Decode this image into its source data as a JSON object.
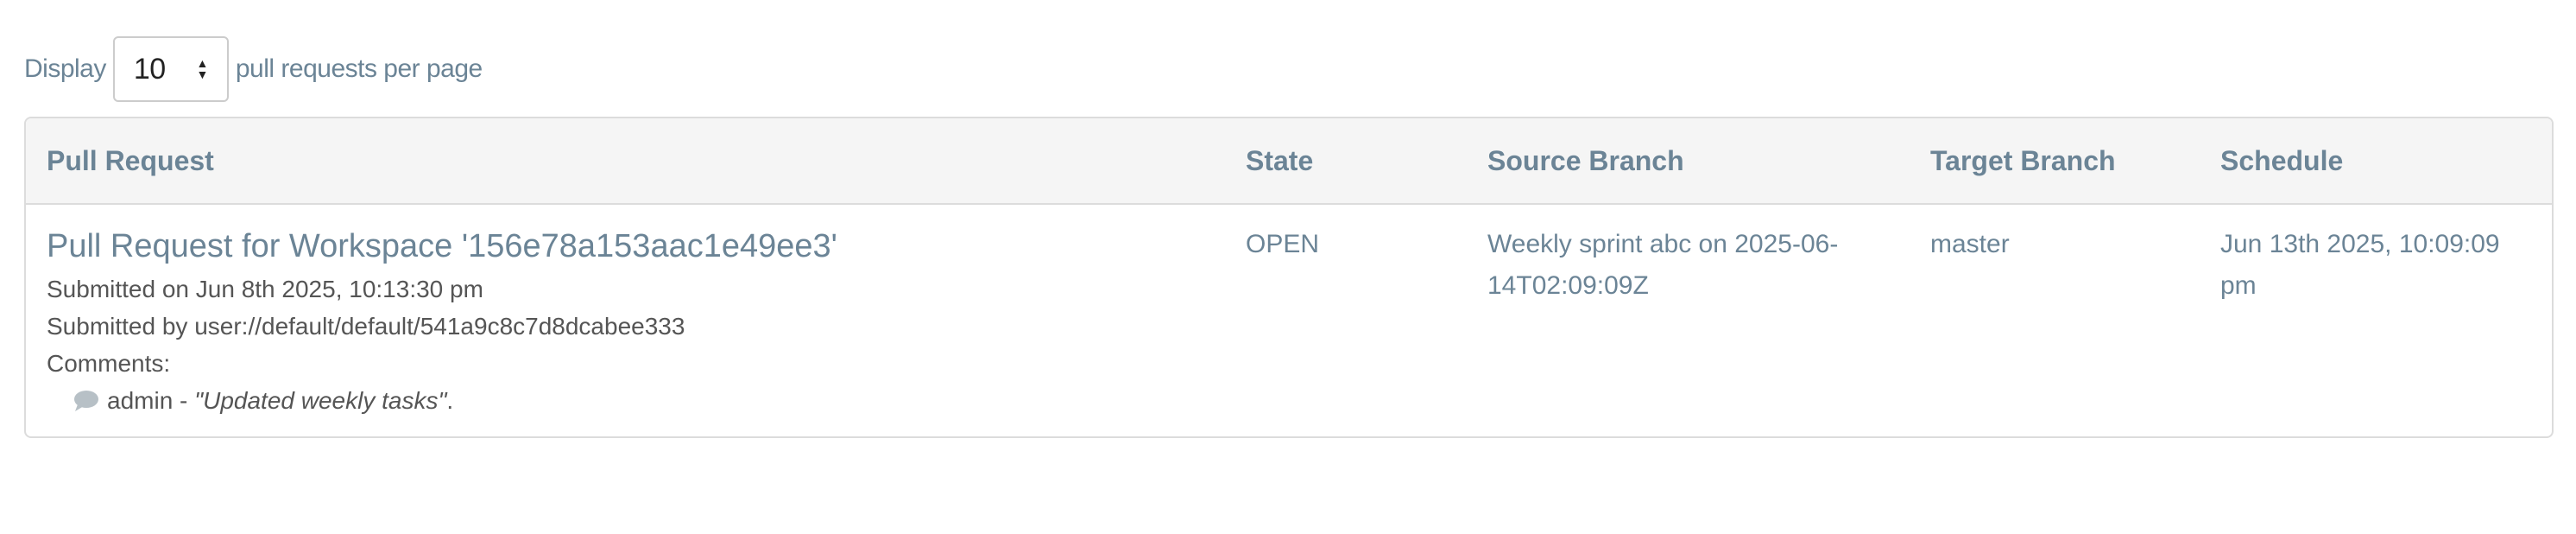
{
  "pagination": {
    "prefix": "Display",
    "selected": "10",
    "suffix": "pull requests per page"
  },
  "table": {
    "headers": [
      "Pull Request",
      "State",
      "Source Branch",
      "Target Branch",
      "Schedule"
    ],
    "rows": [
      {
        "title": "Pull Request for Workspace '156e78a153aac1e49ee3'",
        "submitted_on": "Submitted on Jun 8th 2025, 10:13:30 pm",
        "submitted_by": "Submitted by user://default/default/541a9c8c7d8dcabee333",
        "comments_label": "Comments:",
        "comment_author": "admin",
        "comment_sep": " - ",
        "comment_text": "\"Updated weekly tasks\"",
        "comment_end": ".",
        "state": "OPEN",
        "source_branch": "Weekly sprint abc on 2025-06-14T02:09:09Z",
        "target_branch": "master",
        "schedule": "Jun 13th 2025, 10:09:09 pm"
      }
    ]
  },
  "icons": {
    "comment": "speech-bubble-icon",
    "select_arrows": "sort-arrows-icon"
  },
  "colors": {
    "text_accent": "#6b8496",
    "header_bg": "#f5f5f5",
    "border": "#dcdcdc"
  }
}
